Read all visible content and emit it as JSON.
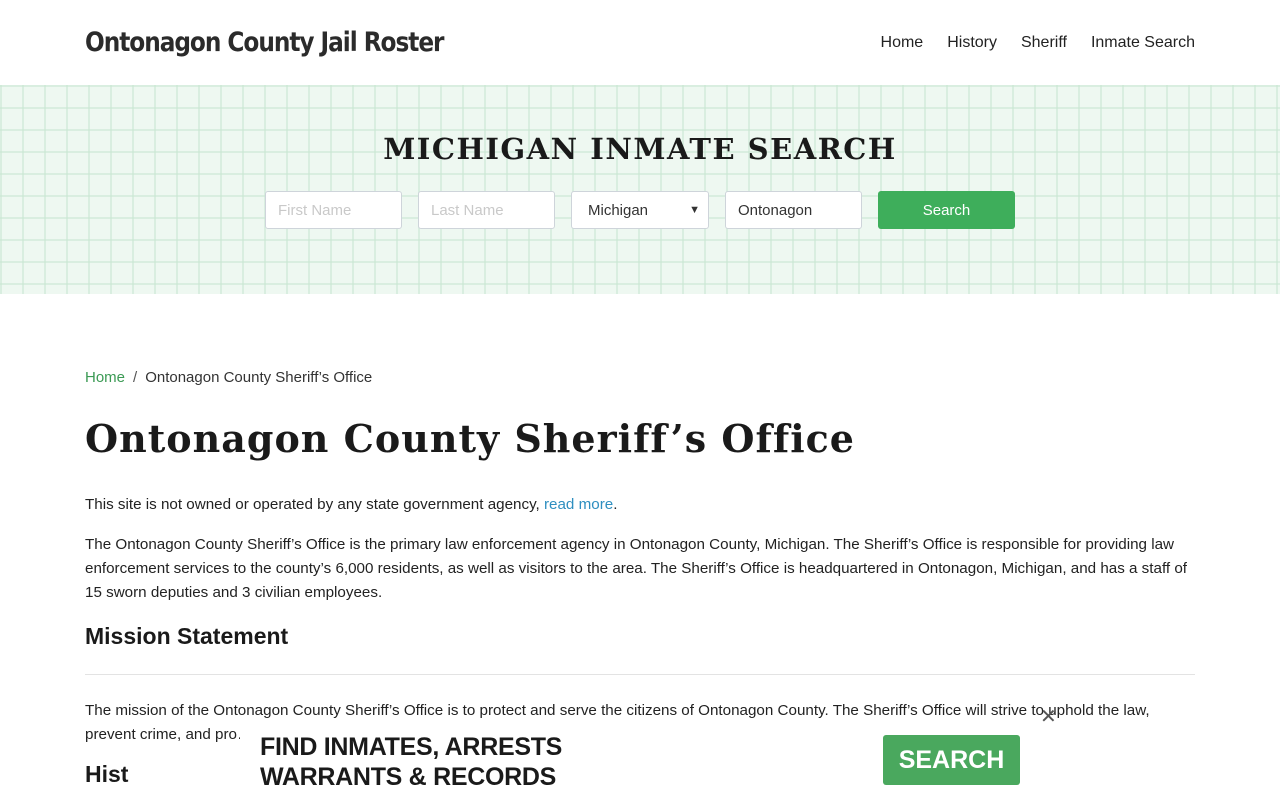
{
  "header": {
    "brand": "Ontonagon County Jail Roster",
    "nav": [
      "Home",
      "History",
      "Sheriff",
      "Inmate Search"
    ]
  },
  "hero": {
    "title": "MICHIGAN INMATE SEARCH",
    "first_name_placeholder": "First Name",
    "last_name_placeholder": "Last Name",
    "state_value": "Michigan",
    "county_value": "Ontonagon",
    "search_label": "Search"
  },
  "breadcrumb": {
    "home": "Home",
    "separator": "/",
    "current": "Ontonagon County Sheriff’s Office"
  },
  "page": {
    "title": "Ontonagon County Sheriff’s Office",
    "disclaimer_text": "This site is not owned or operated by any state government agency, ",
    "disclaimer_link": "read more",
    "disclaimer_end": ".",
    "intro": "The Ontonagon County Sheriff’s Office is the primary law enforcement agency in Ontonagon County, Michigan. The Sheriff’s Office is responsible for providing law enforcement services to the county’s 6,000 residents, as well as visitors to the area. The Sheriff’s Office is headquartered in Ontonagon, Michigan, and has a staff of 15 sworn deputies and 3 civilian employees.",
    "mission_heading": "Mission Statement",
    "mission_text": "The mission of the Ontonagon County Sheriff’s Office is to protect and serve the citizens of Ontonagon County. The Sheriff’s Office will strive to uphold the law, prevent crime, and pro… h the community and other law enforcemen…",
    "next_heading_peek": "Hist"
  },
  "ad": {
    "line1": "FIND INMATES, ARRESTS",
    "line2": "WARRANTS & RECORDS",
    "button": "SEARCH",
    "close": "✕"
  },
  "colors": {
    "accent_green": "#3eae5b",
    "link_blue": "#2f8fc0",
    "hero_bg": "#eef8f1"
  }
}
